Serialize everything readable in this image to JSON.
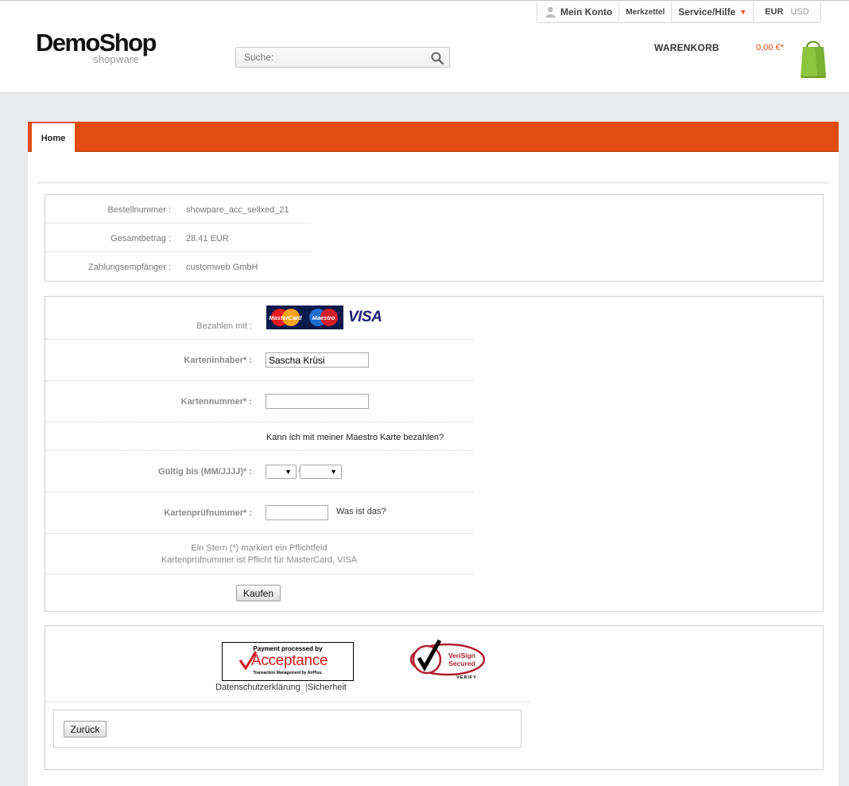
{
  "header": {
    "logo_main": "DemoShop",
    "logo_sub": "shopware",
    "search_placeholder": "Suche:",
    "account": "Mein Konto",
    "wishlist": "Merkzettel",
    "service": "Service/Hilfe",
    "currency_active": "EUR",
    "currency_other": "USD",
    "cart_label": "WARENKORB",
    "cart_amount": "0,00 €*"
  },
  "colors": {
    "accent": "#e04c11",
    "bag": "#8cc63f"
  },
  "nav": {
    "home_tab": "Home"
  },
  "order_info": [
    {
      "label": "Bestellnummer :",
      "value": "showpare_acc_sellxed_21"
    },
    {
      "label": "Gesamtbetrag :",
      "value": "28.41 EUR"
    },
    {
      "label": "Zahlungsempfänger :",
      "value": "customweb GmbH"
    }
  ],
  "payment_form": {
    "pay_with_label": "Bezahlen mit :",
    "card_logos": {
      "mastercard": "MasterCard",
      "maestro": "Maestro",
      "visa": "VISA"
    },
    "holder_label": "Karteninhaber* :",
    "holder_value": "Sascha Krüsi",
    "number_label": "Kartennummer* :",
    "number_value": "",
    "maestro_hint": "Kann ich mit meiner Maestro Karte bezahlen?",
    "expiry_label": "Gültig bis (MM/JJJJ)* :",
    "expiry_month": "",
    "expiry_year": "",
    "expiry_separator": "/",
    "cvc_label": "Kartenprüfnummer* :",
    "cvc_value": "",
    "cvc_help": "Was ist das?",
    "note_line1": "Ein Stern (*) markiert ein Pflichtfeld",
    "note_line2": "Kartenprüfnummer ist Pflicht für MasterCard, VISA",
    "submit": "Kaufen"
  },
  "footer_box": {
    "acceptance_line1": "Payment processed by",
    "acceptance_main": "Acceptance",
    "acceptance_line3": "Transaction Management by AirPlus.",
    "privacy_link": "Datenschutzerklärung",
    "link_separator": "|",
    "security_link": "Sicherheit",
    "verisign_line1": "VeriSign",
    "verisign_line2": "Secured",
    "verisign_verify": "VERIFY",
    "back_button": "Zurück"
  }
}
